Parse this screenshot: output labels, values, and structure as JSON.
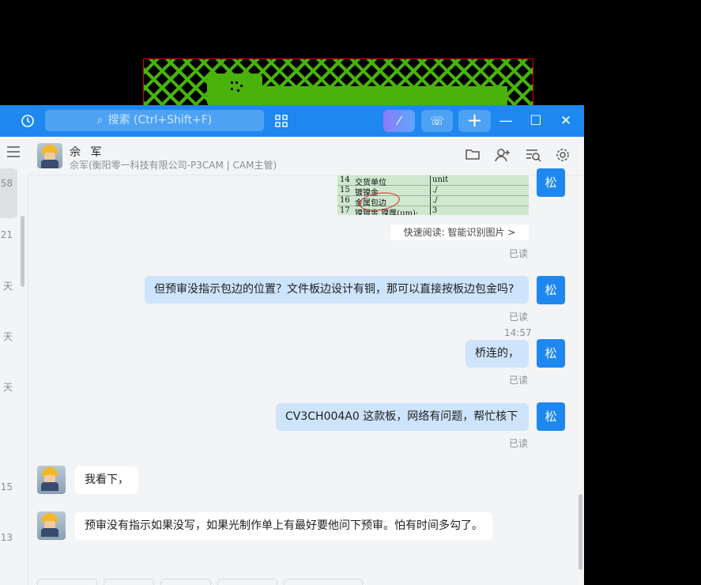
{
  "search": {
    "placeholder": "搜索 (Ctrl+Shift+F)"
  },
  "titlebar": {
    "history_icon": "history-icon",
    "apps_icon": "apps-grid-icon",
    "ai_icon": "magic-wand-icon",
    "call_icon": "phone-icon",
    "add_label": "+",
    "minimize": "—",
    "maximize": "☐",
    "close": "✕"
  },
  "contacts": {
    "times": [
      "58",
      "21",
      "天",
      "天",
      "天",
      "15",
      "13"
    ]
  },
  "chat": {
    "name": "佘 军",
    "subtitle": "佘军(衡阳零一科技有限公司-P3CAM | CAM主管)"
  },
  "table_image": {
    "rows": [
      {
        "no": "14",
        "key": "交货单位",
        "val": "unit"
      },
      {
        "no": "15",
        "key": "镀镍金",
        "val": "./"
      },
      {
        "no": "16",
        "key": "金属包边",
        "val": "./"
      },
      {
        "no": "17",
        "key": "镍镀金  镍厚(um):",
        "val": "3"
      }
    ]
  },
  "quick_read": "快速阅读: 智能识别图片 >",
  "me_avatar": "松",
  "read_label": "已读",
  "messages": [
    {
      "from": "me",
      "text": "但预审没指示包边的位置？文件板边设计有铜，那可以直接按板边包金吗?"
    },
    {
      "from": "me",
      "text": "桥连的，",
      "time": "14:57"
    },
    {
      "from": "me",
      "text": "CV3CH004A0  这款板，网络有问题，帮忙核下"
    },
    {
      "from": "other",
      "text": "我看下，"
    },
    {
      "from": "other",
      "text": "预审没有指示如果没写，如果光制作单上有最好要他问下预审。怕有时间多勾了。"
    }
  ]
}
